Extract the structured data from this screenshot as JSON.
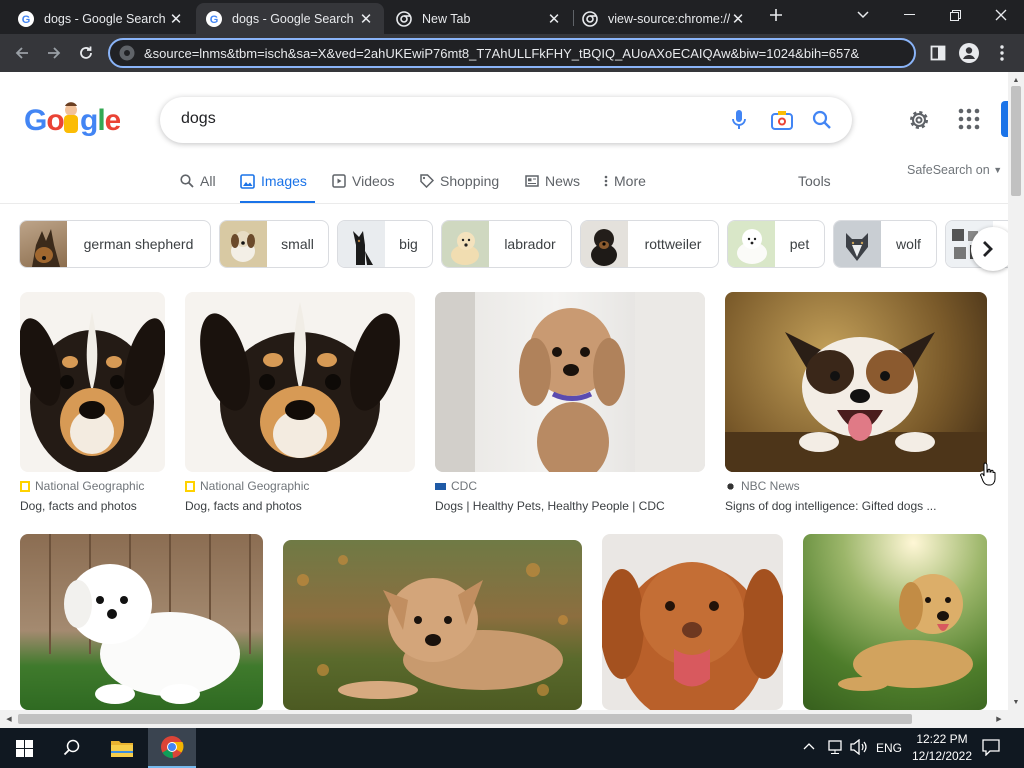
{
  "browser": {
    "tabs": [
      {
        "title": "dogs - Google Search",
        "active": false
      },
      {
        "title": "dogs - Google Search",
        "active": true
      },
      {
        "title": "New Tab",
        "active": false
      },
      {
        "title": "view-source:chrome://",
        "active": false
      }
    ],
    "url": "&source=lnms&tbm=isch&sa=X&ved=2ahUKEwiP76mt8_T7AhULLFkFHY_tBQIQ_AUoAXoECAIQAw&biw=1024&bih=657&"
  },
  "search": {
    "logo": "Google",
    "query": "dogs"
  },
  "nav": {
    "tabs": [
      "All",
      "Images",
      "Videos",
      "Shopping",
      "News",
      "More"
    ],
    "tools": "Tools",
    "safesearch": "SafeSearch on"
  },
  "chips": [
    "german shepherd",
    "small",
    "big",
    "labrador",
    "rottweiler",
    "pet",
    "wolf"
  ],
  "results": [
    {
      "source": "National Geographic",
      "title": "Dog, facts and photos"
    },
    {
      "source": "National Geographic",
      "title": "Dog, facts and photos"
    },
    {
      "source": "CDC",
      "title": "Dogs | Healthy Pets, Healthy People | CDC"
    },
    {
      "source": "NBC News",
      "title": "Signs of dog intelligence: Gifted dogs ..."
    },
    {
      "source": "",
      "title": ""
    },
    {
      "source": "",
      "title": ""
    },
    {
      "source": "",
      "title": ""
    },
    {
      "source": "",
      "title": ""
    }
  ],
  "taskbar": {
    "lang": "ENG",
    "time": "12:22 PM",
    "date": "12/12/2022"
  },
  "colors": {
    "accent": "#1a73e8",
    "tabstrip": "#202124",
    "toolbar": "#35363a",
    "taskbar": "#101821"
  }
}
